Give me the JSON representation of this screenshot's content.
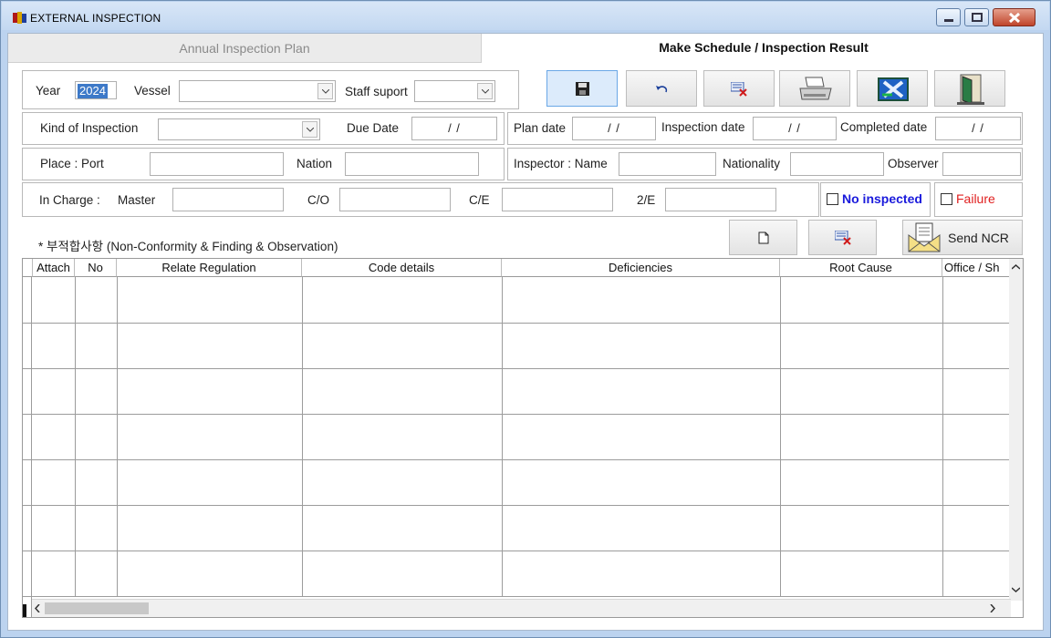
{
  "window": {
    "title": "EXTERNAL INSPECTION"
  },
  "tabs": [
    {
      "label": "Annual Inspection Plan",
      "active": false
    },
    {
      "label": "Make Schedule  /  Inspection Result",
      "active": true
    }
  ],
  "row1": {
    "year_label": "Year",
    "year_value": "2024",
    "vessel_label": "Vessel",
    "vessel_value": "",
    "staff_label": "Staff suport",
    "staff_value": ""
  },
  "toolbar": [
    {
      "icon": "save-icon"
    },
    {
      "icon": "undo-icon"
    },
    {
      "icon": "delete-icon"
    },
    {
      "icon": "print-icon"
    },
    {
      "icon": "excel-icon"
    },
    {
      "icon": "exit-icon"
    }
  ],
  "row2": {
    "kind_label": "Kind of Inspection",
    "kind_value": "",
    "due_label": "Due Date",
    "due_value": "/ /",
    "plan_label": "Plan date",
    "plan_value": "/ /",
    "insp_label": "Inspection date",
    "insp_value": "/ /",
    "comp_label": "Completed date",
    "comp_value": "/ /"
  },
  "row3": {
    "place_label": "Place :  Port",
    "port_value": "",
    "nation_label": "Nation",
    "nation_value": "",
    "inspector_label": "Inspector : Name",
    "inspector_value": "",
    "nationality_label": "Nationality",
    "nationality_value": "",
    "observer_label": "Observer",
    "observer_value": ""
  },
  "row4": {
    "incharge_label": "In Charge  :",
    "master_label": "Master",
    "master_value": "",
    "co_label": "C/O",
    "co_value": "",
    "ce_label": "C/E",
    "ce_value": "",
    "e2_label": "2/E",
    "e2_value": "",
    "no_inspected_label": "No inspected",
    "no_inspected_checked": false,
    "failure_label": "Failure",
    "failure_checked": false
  },
  "section": {
    "note": "* 부적합사항 (Non-Conformity & Finding & Observation)",
    "send_ncr_label": "Send NCR"
  },
  "colors": {
    "no_inspected": "#1a1adc",
    "failure": "#e02020",
    "selection": "#3d79c8"
  },
  "grid": {
    "columns": [
      "Attach",
      "No",
      "Relate Regulation",
      "Code details",
      "Deficiencies",
      "Root Cause",
      "Office / Sh"
    ],
    "rows": [
      [],
      [],
      [],
      [],
      [],
      [],
      []
    ]
  }
}
